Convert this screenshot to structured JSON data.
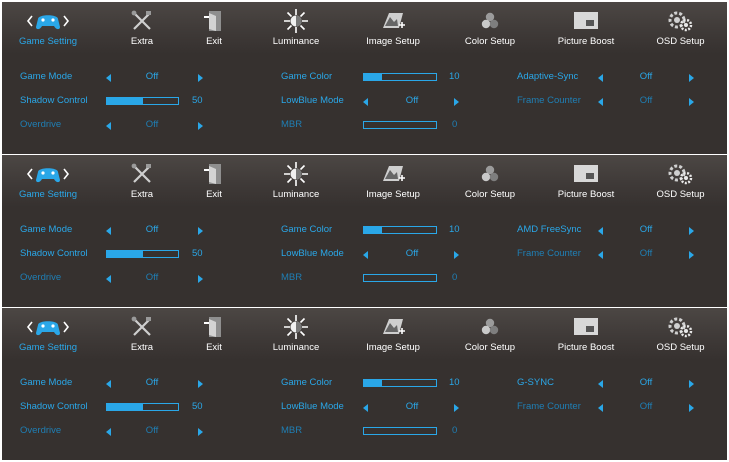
{
  "tabs": [
    {
      "label": "Game Setting",
      "icon": "gamepad-icon",
      "active": true
    },
    {
      "label": "Extra",
      "icon": "tools-icon"
    },
    {
      "label": "Exit",
      "icon": "exit-door-icon"
    },
    {
      "label": "Luminance",
      "icon": "sun-icon"
    },
    {
      "label": "Image Setup",
      "icon": "image-setup-icon"
    },
    {
      "label": "Color Setup",
      "icon": "color-circles-icon"
    },
    {
      "label": "Picture Boost",
      "icon": "picture-boost-icon"
    },
    {
      "label": "OSD Setup",
      "icon": "osd-gear-icon"
    }
  ],
  "panels": [
    {
      "game_mode": {
        "label": "Game Mode",
        "value": "Off"
      },
      "shadow_control": {
        "label": "Shadow Control",
        "value": "50",
        "level": 0.5
      },
      "overdrive": {
        "label": "Overdrive",
        "value": "Off"
      },
      "game_color": {
        "label": "Game Color",
        "value": "10",
        "level": 0.25
      },
      "lowblue_mode": {
        "label": "LowBlue Mode",
        "value": "Off"
      },
      "mbr": {
        "label": "MBR",
        "value": "0",
        "level": 0
      },
      "sync": {
        "label": "Adaptive-Sync",
        "value": "Off"
      },
      "frame_counter": {
        "label": "Frame Counter",
        "value": "Off"
      }
    },
    {
      "game_mode": {
        "label": "Game Mode",
        "value": "Off"
      },
      "shadow_control": {
        "label": "Shadow Control",
        "value": "50",
        "level": 0.5
      },
      "overdrive": {
        "label": "Overdrive",
        "value": "Off"
      },
      "game_color": {
        "label": "Game Color",
        "value": "10",
        "level": 0.25
      },
      "lowblue_mode": {
        "label": "LowBlue Mode",
        "value": "Off"
      },
      "mbr": {
        "label": "MBR",
        "value": "0",
        "level": 0
      },
      "sync": {
        "label": "AMD FreeSync",
        "value": "Off"
      },
      "frame_counter": {
        "label": "Frame Counter",
        "value": "Off"
      }
    },
    {
      "game_mode": {
        "label": "Game Mode",
        "value": "Off"
      },
      "shadow_control": {
        "label": "Shadow Control",
        "value": "50",
        "level": 0.5
      },
      "overdrive": {
        "label": "Overdrive",
        "value": "Off"
      },
      "game_color": {
        "label": "Game Color",
        "value": "10",
        "level": 0.25
      },
      "lowblue_mode": {
        "label": "LowBlue Mode",
        "value": "Off"
      },
      "mbr": {
        "label": "MBR",
        "value": "0",
        "level": 0
      },
      "sync": {
        "label": "G-SYNC",
        "value": "Off"
      },
      "frame_counter": {
        "label": "Frame Counter",
        "value": "Off"
      }
    }
  ],
  "colors": {
    "accent": "#2aa7e8",
    "panel_bg": "#36312f",
    "tab_text": "#ffffff"
  }
}
